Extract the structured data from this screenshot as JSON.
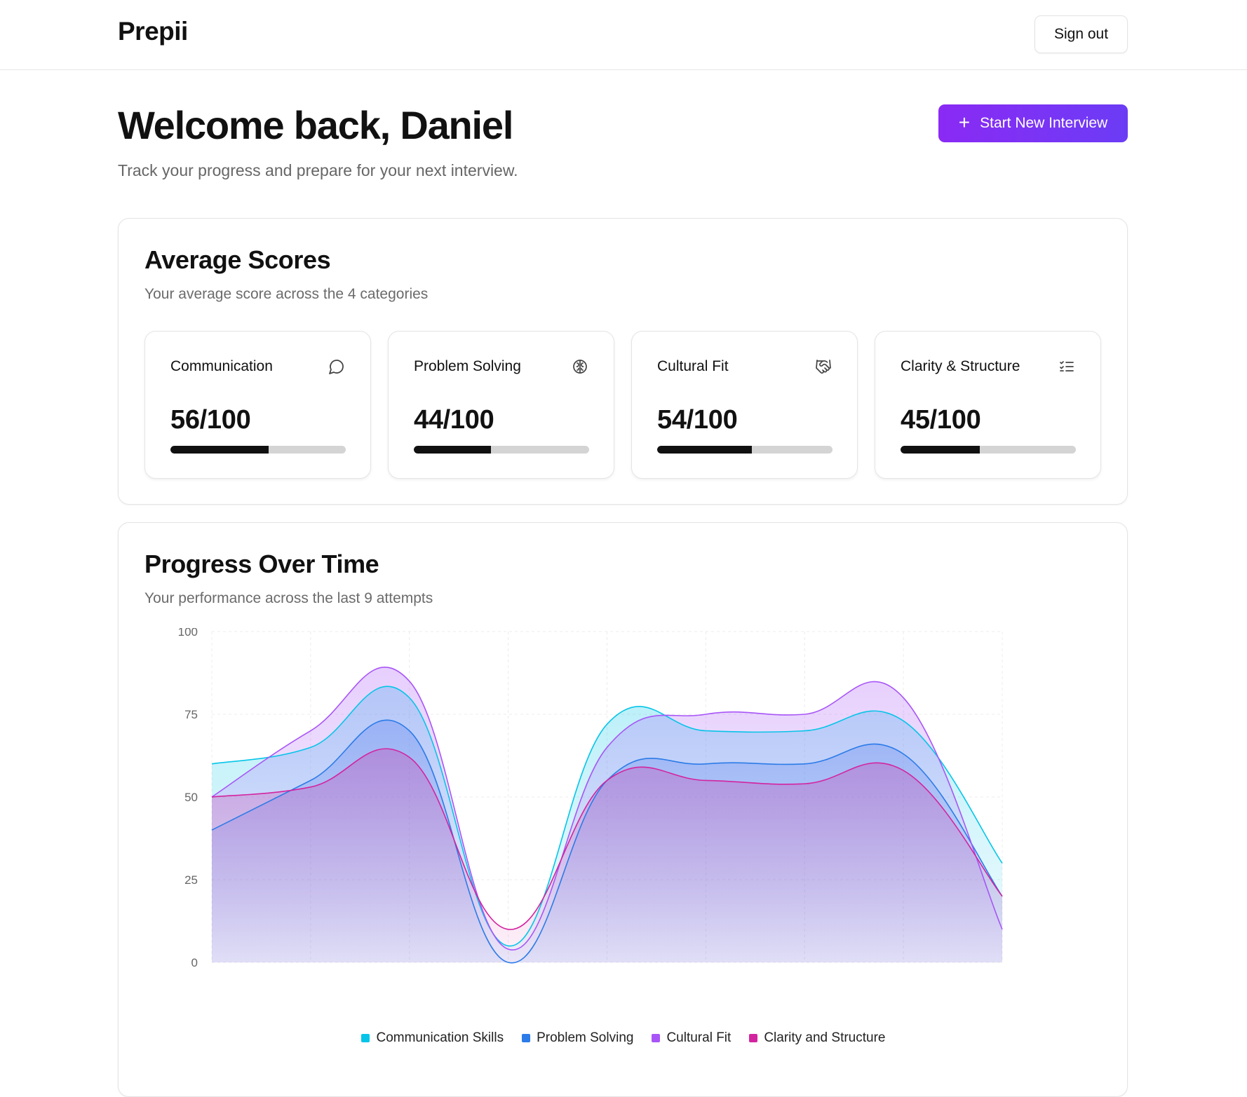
{
  "header": {
    "brand": "Prepii",
    "signout_label": "Sign out"
  },
  "hero": {
    "title": "Welcome back, Daniel",
    "subtitle": "Track your progress and prepare for your next interview.",
    "start_button_label": "Start New Interview",
    "start_button_icon": "plus-icon"
  },
  "average_scores": {
    "title": "Average Scores",
    "subtitle": "Your average score across the 4 categories",
    "cards": [
      {
        "label": "Communication",
        "value": "56/100",
        "score": 56,
        "icon": "message-circle-icon"
      },
      {
        "label": "Problem Solving",
        "value": "44/100",
        "score": 44,
        "icon": "brain-icon"
      },
      {
        "label": "Cultural Fit",
        "value": "54/100",
        "score": 54,
        "icon": "handshake-icon"
      },
      {
        "label": "Clarity & Structure",
        "value": "45/100",
        "score": 45,
        "icon": "list-checks-icon"
      }
    ]
  },
  "progress": {
    "title": "Progress Over Time",
    "subtitle": "Your performance across the last 9 attempts"
  },
  "chart_data": {
    "type": "area",
    "x": [
      1,
      2,
      3,
      4,
      5,
      6,
      7,
      8,
      9
    ],
    "ylim": [
      0,
      100
    ],
    "yticks": [
      "0",
      "25",
      "50",
      "75",
      "100"
    ],
    "grid": true,
    "legend_position": "bottom",
    "series": [
      {
        "name": "Communication Skills",
        "color": "#06c5e8",
        "values": [
          60,
          65,
          80,
          5,
          72,
          70,
          70,
          73,
          30
        ]
      },
      {
        "name": "Problem Solving",
        "color": "#2b7be8",
        "values": [
          40,
          55,
          70,
          0,
          55,
          60,
          60,
          63,
          20
        ]
      },
      {
        "name": "Cultural Fit",
        "color": "#a855f7",
        "values": [
          50,
          70,
          85,
          4,
          65,
          75,
          75,
          80,
          10
        ]
      },
      {
        "name": "Clarity and Structure",
        "color": "#d3249f",
        "values": [
          50,
          53,
          62,
          10,
          55,
          55,
          54,
          58,
          20
        ]
      }
    ]
  }
}
